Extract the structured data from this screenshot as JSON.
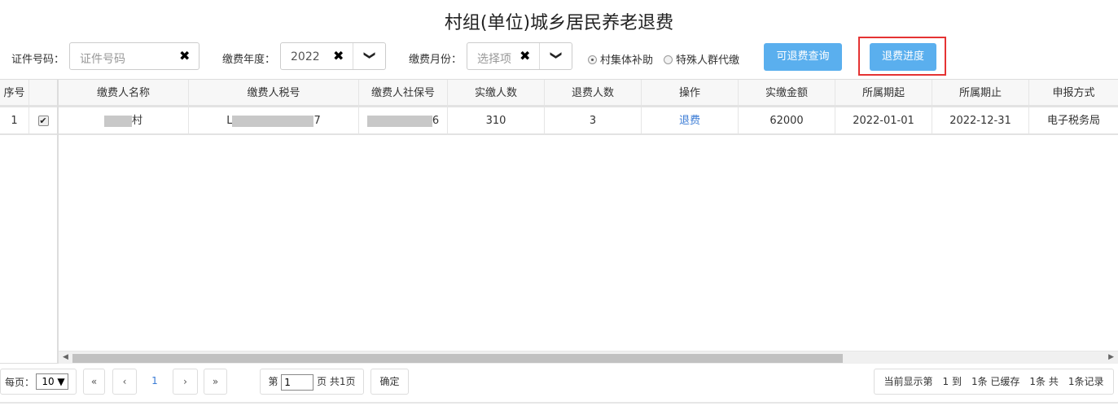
{
  "title": "村组(单位)城乡居民养老退费",
  "filters": {
    "id_label": "证件号码：",
    "id_placeholder": "证件号码",
    "year_label": "缴费年度：",
    "year_value": "2022",
    "month_label": "缴费月份：",
    "month_placeholder": "选择项",
    "clear_icon": "✖",
    "dropdown_icon": "❯",
    "radio1": "村集体补助",
    "radio2": "特殊人群代缴",
    "query_button": "可退费查询",
    "progress_button": "退费进度"
  },
  "table": {
    "headers": {
      "seq": "序号",
      "name": "缴费人名称",
      "tax_id": "缴费人税号",
      "ss_id": "缴费人社保号",
      "paid_count": "实缴人数",
      "refund_count": "退费人数",
      "action": "操作",
      "amount": "实缴金额",
      "start": "所属期起",
      "end": "所属期止",
      "method": "申报方式"
    },
    "rows": [
      {
        "seq": "1",
        "checked": "✔",
        "name_suffix": "村",
        "tax_prefix": "L",
        "tax_suffix": "7",
        "ss_suffix": "6",
        "paid_count": "310",
        "refund_count": "3",
        "action": "退费",
        "amount": "62000",
        "start": "2022-01-01",
        "end": "2022-12-31",
        "method": "电子税务局"
      }
    ]
  },
  "pager": {
    "per_page_label": "每页：",
    "per_page_value": "10 ▼",
    "first": "«",
    "prev": "‹",
    "current": "1",
    "next": "›",
    "last": "»",
    "page_prefix": "第",
    "page_input": "1",
    "page_suffix": "页 共1页",
    "confirm": "确定",
    "summary": "当前显示第　1 到　1条 已缓存　1条 共　1条记录"
  },
  "colors": {
    "accent": "#5aafee",
    "highlight": "#e53333",
    "link": "#3a7bd5"
  }
}
